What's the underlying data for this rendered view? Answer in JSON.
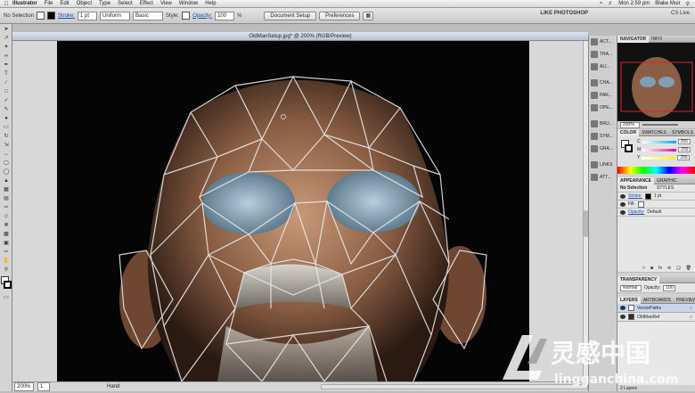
{
  "menubar": {
    "app": "Illustrator",
    "items": [
      "File",
      "Edit",
      "Object",
      "Type",
      "Select",
      "Effect",
      "View",
      "Window",
      "Help"
    ],
    "clock": "Mon 2:59 pm",
    "user": "Blake Muir"
  },
  "control": {
    "selection": "No Selection",
    "stroke_label": "Stroke:",
    "stroke_weight": "1 pt",
    "profile": "Uniform",
    "brush": "Basic",
    "style_label": "Style:",
    "opacity_label": "Opacity:",
    "opacity": "100",
    "opacity_unit": "%",
    "document_setup": "Document Setup",
    "preferences": "Preferences",
    "workspace": "LIKE PHOTOSHOP",
    "cs_live": "CS Live"
  },
  "document": {
    "tab_title": "OldManSetup.jpg* @ 200% (RGB/Preview)",
    "zoom": "200%",
    "page": "1",
    "status": "Hand"
  },
  "iconstrip": [
    "ACT...",
    "TRA...",
    "ALI...",
    "CHA...",
    "PAR...",
    "OPE...",
    "BRU...",
    "SYM...",
    "GRA...",
    "LINKS",
    "ATT..."
  ],
  "navigator": {
    "tabs": [
      "NAVIGATOR",
      "INFO"
    ],
    "zoom": "200%"
  },
  "color": {
    "tabs": [
      "COLOR",
      "SWATCHES",
      "SYMBOLS"
    ],
    "channels": [
      {
        "name": "C",
        "value": "255"
      },
      {
        "name": "M",
        "value": "255"
      },
      {
        "name": "Y",
        "value": "255"
      }
    ]
  },
  "appearance": {
    "tabs": [
      "APPEARANCE",
      "GRAPHIC STYLES"
    ],
    "title": "No Selection",
    "stroke_label": "Stroke:",
    "stroke_value": "1 pt",
    "fill_label": "Fill:",
    "opacity_label": "Opacity:",
    "opacity_value": "Default"
  },
  "transparency": {
    "tab": "TRANSPARENCY",
    "mode": "Normal",
    "opacity_label": "Opacity:",
    "opacity": "100"
  },
  "layers": {
    "tabs": [
      "LAYERS",
      "ARTBOARDS",
      "PREVIEW"
    ],
    "items": [
      "VectorPaths",
      "OldManRef"
    ],
    "count": "2 Layers"
  },
  "watermark": {
    "cn": "灵感中国",
    "url": "lingganchina.com"
  }
}
